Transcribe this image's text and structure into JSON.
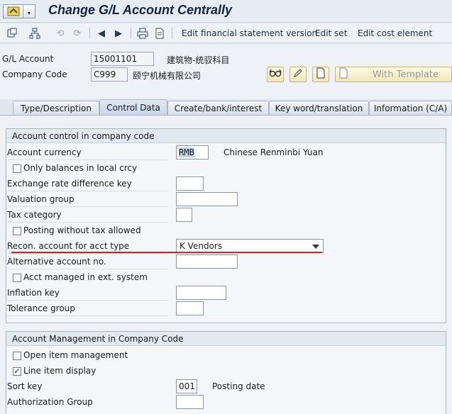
{
  "window": {
    "title": "Change G/L Account Centrally"
  },
  "toolbar": {
    "edit_fs_version": "Edit financial statement version",
    "edit_set": "Edit set",
    "edit_cost_element": "Edit cost element"
  },
  "header": {
    "gl_account_label": "G/L Account",
    "gl_account_value": "15001101",
    "gl_account_desc": "建筑物-统驭科目",
    "company_code_label": "Company Code",
    "company_code_value": "C999",
    "company_code_desc": "颐宁机械有限公司",
    "with_template": "With Template"
  },
  "tabs": [
    {
      "label": "Type/Description"
    },
    {
      "label": "Control Data",
      "active": true
    },
    {
      "label": "Create/bank/interest"
    },
    {
      "label": "Key word/translation"
    },
    {
      "label": "Information (C/A)"
    }
  ],
  "group1": {
    "title": "Account control in company code",
    "account_currency_label": "Account currency",
    "account_currency_value": "RMB",
    "account_currency_desc": "Chinese Renminbi Yuan",
    "only_balances_label": "Only balances in local crcy",
    "only_balances_checked": false,
    "exch_rate_label": "Exchange rate difference key",
    "exch_rate_value": "",
    "valuation_group_label": "Valuation group",
    "valuation_group_value": "",
    "tax_category_label": "Tax category",
    "tax_category_value": "",
    "posting_without_tax_label": "Posting without tax allowed",
    "posting_without_tax_checked": false,
    "recon_label": "Recon. account for acct type",
    "recon_value": "K Vendors",
    "alt_account_label": "Alternative account no.",
    "alt_account_value": "",
    "acct_ext_label": "Acct managed in ext. system",
    "acct_ext_checked": false,
    "inflation_key_label": "Inflation key",
    "inflation_key_value": "",
    "tolerance_group_label": "Tolerance group",
    "tolerance_group_value": ""
  },
  "group2": {
    "title": "Account Management in Company Code",
    "open_item_label": "Open item management",
    "open_item_checked": false,
    "line_item_label": "Line item display",
    "line_item_checked": true,
    "line_item_mark": "✓",
    "sort_key_label": "Sort key",
    "sort_key_value": "001",
    "sort_key_desc": "Posting date",
    "auth_group_label": "Authorization Group",
    "auth_group_value": ""
  },
  "colors": {
    "accent_red": "#e01e1e",
    "title_blue": "#10243d"
  }
}
